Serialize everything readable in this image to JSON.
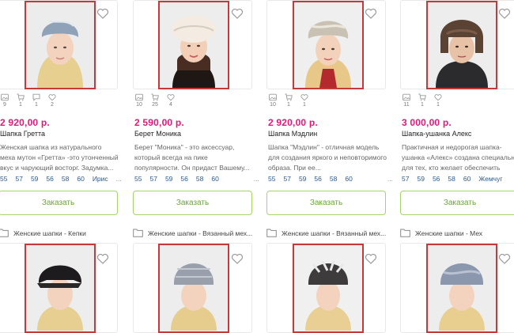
{
  "products": [
    {
      "stats": [
        "9",
        "1",
        "1",
        "2"
      ],
      "price": "2 920,00 р.",
      "name": "Шапка Гретта",
      "description": "Женская шапка из натурального меха мутон «Гретта» -это утонченный вкус и чарующий восторг. Задумка...",
      "sizes": [
        "55",
        "57",
        "59",
        "56",
        "58",
        "60",
        "Ирис"
      ],
      "sizes_more": "...",
      "order_label": "Заказать",
      "category": "Женские шапки - Кепки"
    },
    {
      "stats": [
        "10",
        "25",
        "4"
      ],
      "price": "2 590,00 р.",
      "name": "Берет Моника",
      "description": "Берет \"Моника\" - это аксессуар, который всегда на пике популярности. Он придаст Вашему...",
      "sizes": [
        "55",
        "57",
        "59",
        "56",
        "58",
        "60"
      ],
      "sizes_more": "...",
      "order_label": "Заказать",
      "category": "Женские шапки - Вязанный мех..."
    },
    {
      "stats": [
        "10",
        "1",
        "1"
      ],
      "price": "2 920,00 р.",
      "name": "Шапка Мэдлин",
      "description": "Шапка \"Мэдлин\" - отличная модель для создания яркого и неповторимого образа. При ее...",
      "sizes": [
        "55",
        "57",
        "59",
        "56",
        "58",
        "60"
      ],
      "sizes_more": "...",
      "order_label": "Заказать",
      "category": "Женские шапки - Вязанный мех..."
    },
    {
      "stats": [
        "11",
        "1",
        "1"
      ],
      "price": "3 000,00 р.",
      "name": "Шапка-ушанка Алекс",
      "description": "Практичная и недорогая шапка-ушанка «Алекс» создана специально для тех, кто желает обеспечить себе...",
      "sizes": [
        "57",
        "59",
        "56",
        "58",
        "60",
        "Жемчуг"
      ],
      "sizes_more": "",
      "order_label": "Заказать",
      "category": "Женские шапки - Мех"
    }
  ],
  "colors": {
    "price": "#e5177a",
    "order_border": "#a7d36b",
    "order_text": "#6aa63a",
    "size_link": "#2a5a94",
    "photo_frame": "#c43a3a"
  },
  "icons": [
    "photos-icon",
    "cart-icon",
    "comment-icon",
    "heart-icon",
    "folder-icon"
  ]
}
